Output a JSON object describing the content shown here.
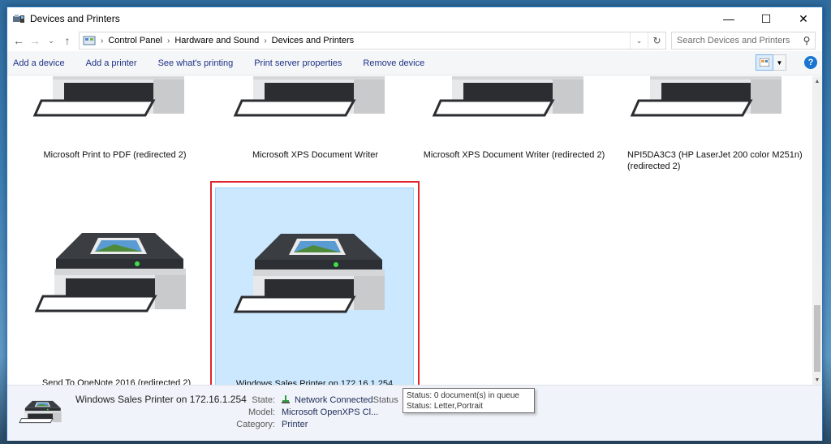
{
  "window": {
    "title": "Devices and Printers",
    "controls": {
      "minimize": "—",
      "maximize": "☐",
      "close": "✕"
    }
  },
  "address": {
    "breadcrumbs": [
      "Control Panel",
      "Hardware and Sound",
      "Devices and Printers"
    ],
    "search_placeholder": "Search Devices and Printers"
  },
  "toolbar": {
    "commands": [
      "Add a device",
      "Add a printer",
      "See what's printing",
      "Print server properties",
      "Remove device"
    ]
  },
  "devices": [
    {
      "name": "Microsoft Print to PDF (redirected 2)"
    },
    {
      "name": "Microsoft XPS Document Writer"
    },
    {
      "name": "Microsoft XPS Document Writer (redirected 2)"
    },
    {
      "name": "NPI5DA3C3 (HP LaserJet 200 color M251n) (redirected 2)"
    },
    {
      "name": "Send To OneNote 2016 (redirected 2)"
    },
    {
      "name": "Windows Sales Printer on 172.16.1.254",
      "selected": true
    }
  ],
  "details": {
    "device_name": "Windows Sales Printer on 172.16.1.254",
    "state_label": "State:",
    "state_value": "Network Connected",
    "state_suffix": "Status",
    "model_label": "Model:",
    "model_value": "Microsoft OpenXPS Cl...",
    "category_label": "Category:",
    "category_value": "Printer"
  },
  "tooltip": {
    "line1": "Status: 0 document(s) in queue",
    "line2": "Status: Letter,Portrait"
  },
  "colors": {
    "selection_bg": "#cce8ff",
    "highlight_border": "#e0262b",
    "link_text": "#1e3287"
  }
}
